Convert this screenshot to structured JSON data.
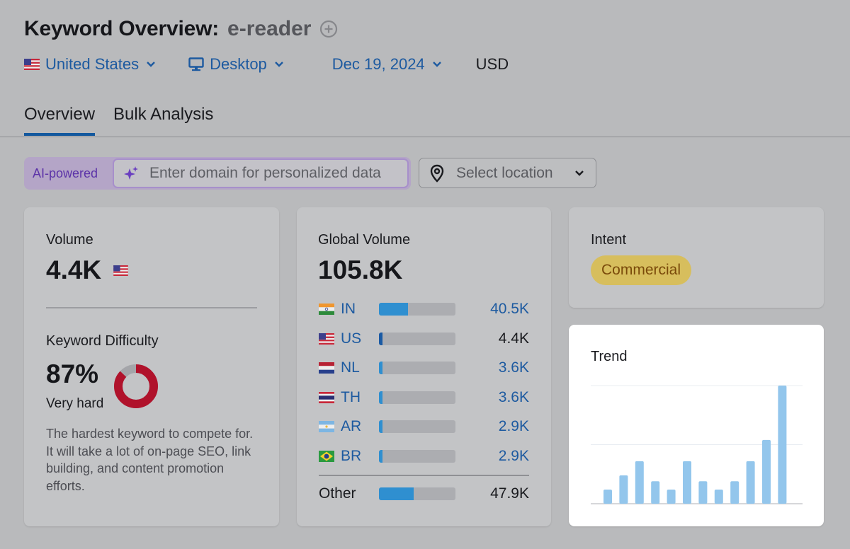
{
  "header": {
    "title": "Keyword Overview:",
    "keyword": "e-reader",
    "add_icon": "plus-circle-icon"
  },
  "filters": {
    "country": "United States",
    "device": "Desktop",
    "date": "Dec 19, 2024",
    "currency": "USD"
  },
  "tabs": [
    {
      "label": "Overview",
      "active": true
    },
    {
      "label": "Bulk Analysis",
      "active": false
    }
  ],
  "personalization": {
    "ai_label": "AI-powered",
    "domain_placeholder": "Enter domain for personalized data",
    "location_placeholder": "Select location"
  },
  "volume_card": {
    "label": "Volume",
    "value": "4.4K",
    "flag": "US"
  },
  "difficulty": {
    "label": "Keyword Difficulty",
    "value": "87%",
    "percent": 87,
    "rating": "Very hard",
    "description": "The hardest keyword to compete for. It will take a lot of on-page SEO, link building, and content promotion efforts.",
    "color": "#b0122b"
  },
  "global_volume": {
    "label": "Global Volume",
    "value": "105.8K",
    "countries": [
      {
        "code": "IN",
        "value": "40.5K",
        "share": 0.383,
        "link": true
      },
      {
        "code": "US",
        "value": "4.4K",
        "share": 0.042,
        "link": false
      },
      {
        "code": "NL",
        "value": "3.6K",
        "share": 0.034,
        "link": true
      },
      {
        "code": "TH",
        "value": "3.6K",
        "share": 0.034,
        "link": true
      },
      {
        "code": "AR",
        "value": "2.9K",
        "share": 0.027,
        "link": true
      },
      {
        "code": "BR",
        "value": "2.9K",
        "share": 0.027,
        "link": true
      }
    ],
    "other": {
      "label": "Other",
      "value": "47.9K",
      "share": 0.453
    }
  },
  "intent": {
    "label": "Intent",
    "value": "Commercial"
  },
  "trend": {
    "label": "Trend"
  },
  "chart_data": {
    "type": "bar",
    "title": "Trend",
    "categories": [
      "1",
      "2",
      "3",
      "4",
      "5",
      "6",
      "7",
      "8",
      "9",
      "10",
      "11",
      "12"
    ],
    "values": [
      0.12,
      0.24,
      0.36,
      0.19,
      0.12,
      0.36,
      0.19,
      0.12,
      0.19,
      0.36,
      0.54,
      1.0
    ],
    "ylim": [
      0,
      1
    ],
    "grid": true,
    "xlabel": "",
    "ylabel": "",
    "color": "#93c6ec"
  }
}
